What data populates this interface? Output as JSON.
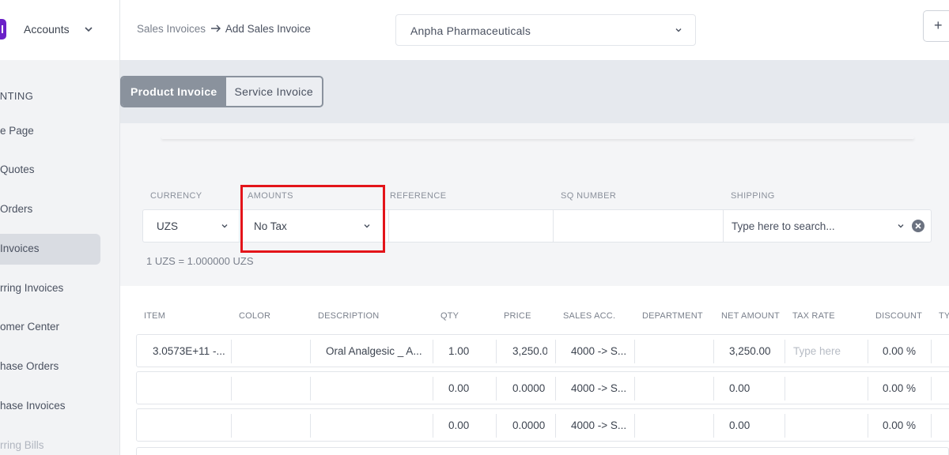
{
  "sidebar": {
    "app_name": "Accounts",
    "section": "UNTING",
    "items": [
      {
        "label": "e Page"
      },
      {
        "label": "Quotes"
      },
      {
        "label": "Orders"
      },
      {
        "label": "Invoices"
      },
      {
        "label": "rring Invoices"
      },
      {
        "label": "omer Center"
      },
      {
        "label": "hase Orders"
      },
      {
        "label": "hase Invoices"
      },
      {
        "label": "rring Bills"
      }
    ]
  },
  "header": {
    "breadcrumb_parent": "Sales Invoices",
    "breadcrumb_current": "Add Sales Invoice",
    "company": "Anpha Pharmaceuticals",
    "plus_label": "+"
  },
  "tabs": {
    "product": "Product Invoice",
    "service": "Service Invoice"
  },
  "form": {
    "labels": {
      "currency": "CURRENCY",
      "amounts": "AMOUNTS",
      "reference": "REFERENCE",
      "sq_number": "SQ NUMBER",
      "shipping": "SHIPPING"
    },
    "currency_value": "UZS",
    "amounts_value": "No Tax",
    "reference_value": "",
    "sq_number_value": "",
    "shipping_placeholder": "Type here to search...",
    "rate_note": "1 UZS = 1.000000 UZS"
  },
  "table": {
    "headers": [
      "ITEM",
      "COLOR",
      "DESCRIPTION",
      "QTY",
      "PRICE",
      "SALES ACC.",
      "DEPARTMENT",
      "NET AMOUNT",
      "TAX RATE",
      "DISCOUNT",
      "TY"
    ],
    "rows": [
      {
        "item": "3.0573E+11 -...",
        "color": "",
        "description": "Oral Analgesic _ A...",
        "qty": "1.00",
        "price": "3,250.0",
        "sales_acc": "4000 -> S...",
        "department": "",
        "net_amount": "3,250.00",
        "tax_rate": "Type here",
        "discount": "0.00 %"
      },
      {
        "item": "",
        "color": "",
        "description": "",
        "qty": "0.00",
        "price": "0.0000",
        "sales_acc": "4000 -> S...",
        "department": "",
        "net_amount": "0.00",
        "tax_rate": "",
        "discount": "0.00 %"
      },
      {
        "item": "",
        "color": "",
        "description": "",
        "qty": "0.00",
        "price": "0.0000",
        "sales_acc": "4000 -> S...",
        "department": "",
        "net_amount": "0.00",
        "tax_rate": "",
        "discount": "0.00 %"
      }
    ]
  },
  "colors": {
    "brand": "#6b21c8",
    "highlight": "#e3141a",
    "active_tab": "#8a929d"
  }
}
